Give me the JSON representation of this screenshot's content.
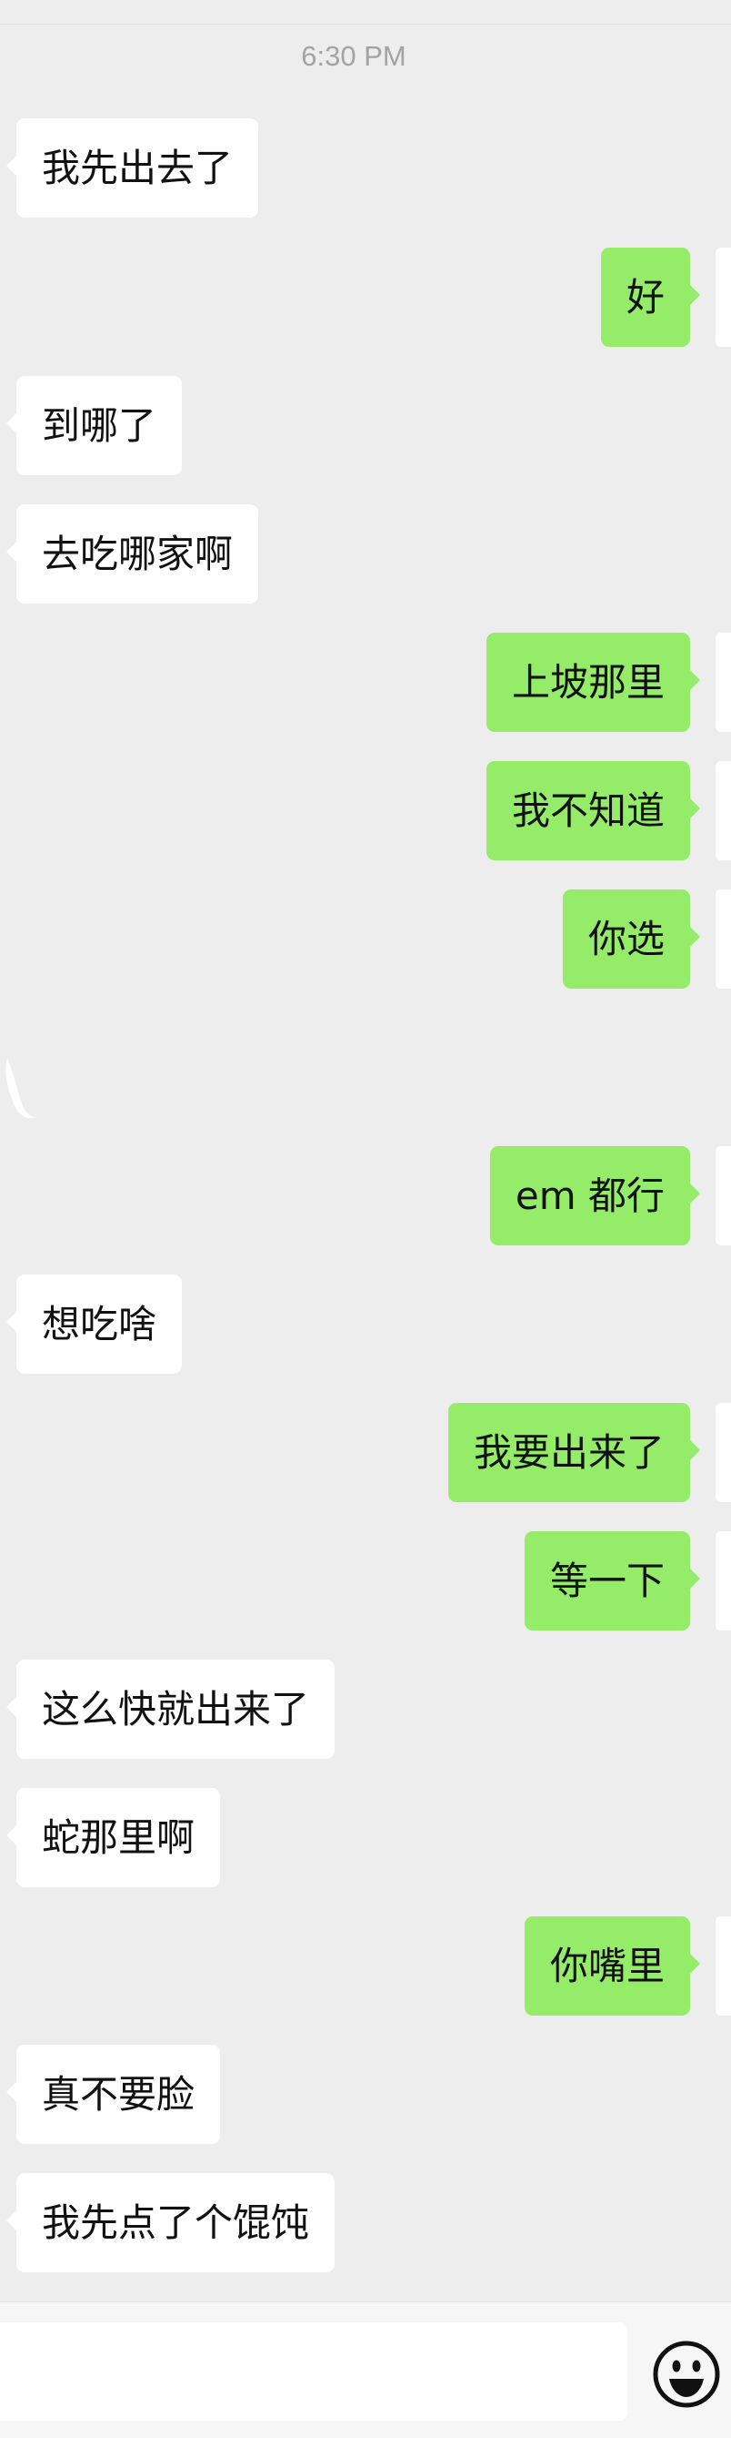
{
  "timestamp": "6:30 PM",
  "messages": [
    {
      "sender": "other",
      "text": "我先出去了"
    },
    {
      "sender": "self",
      "text": "好"
    },
    {
      "sender": "other",
      "text": "到哪了"
    },
    {
      "sender": "other",
      "text": "去吃哪家啊"
    },
    {
      "sender": "self",
      "text": "上坡那里"
    },
    {
      "sender": "self",
      "text": "我不知道"
    },
    {
      "sender": "self",
      "text": "你选"
    },
    {
      "sender": "self",
      "text": "em 都行"
    },
    {
      "sender": "other",
      "text": "想吃啥"
    },
    {
      "sender": "self",
      "text": "我要出来了"
    },
    {
      "sender": "self",
      "text": "等一下"
    },
    {
      "sender": "other",
      "text": "这么快就出来了"
    },
    {
      "sender": "other",
      "text": "蛇那里啊"
    },
    {
      "sender": "self",
      "text": "你嘴里"
    },
    {
      "sender": "other",
      "text": "真不要脸"
    },
    {
      "sender": "other",
      "text": "我先点了个馄饨"
    }
  ],
  "composer": {
    "input_value": "",
    "emoji_icon": "smiley-face-icon"
  },
  "colors": {
    "background": "#ededed",
    "incoming_bubble": "#ffffff",
    "outgoing_bubble": "#95ec69",
    "text": "#111111",
    "timestamp": "#a3a3a3"
  }
}
